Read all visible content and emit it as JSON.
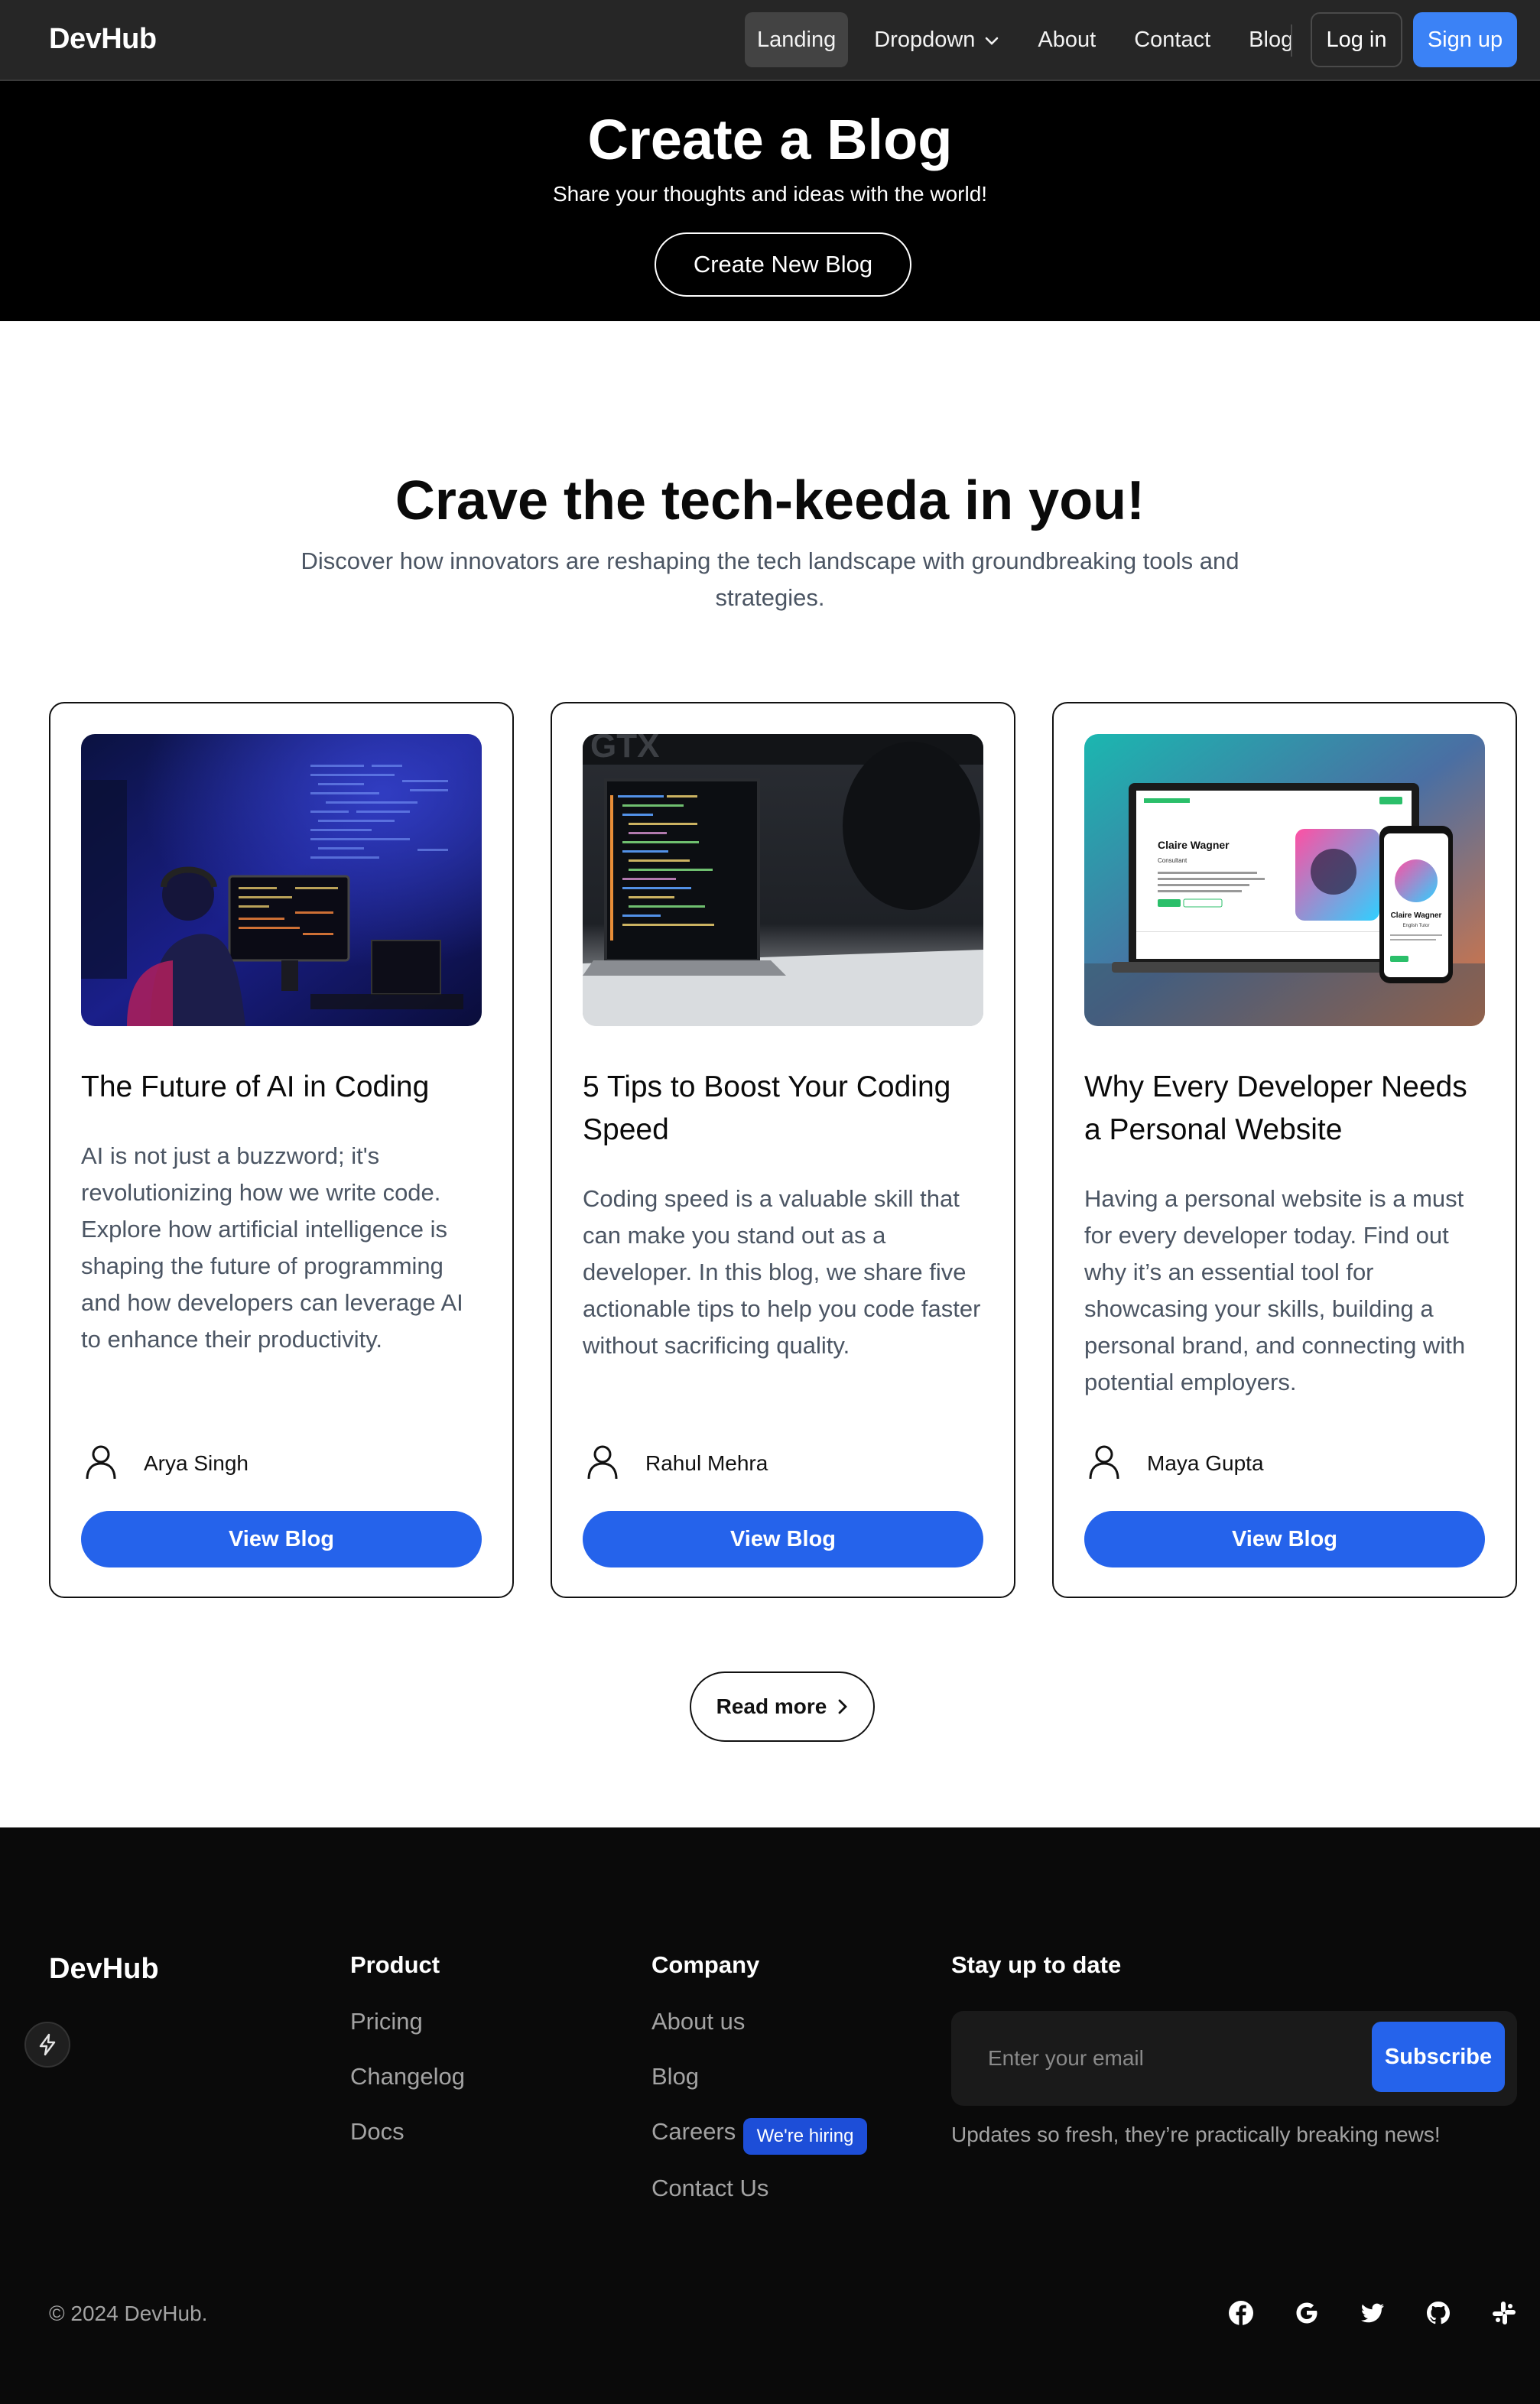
{
  "nav": {
    "brand": "DevHub",
    "links": [
      {
        "label": "Landing",
        "active": true
      },
      {
        "label": "Dropdown"
      },
      {
        "label": "About"
      },
      {
        "label": "Contact"
      },
      {
        "label": "Blog"
      }
    ],
    "login_label": "Log in",
    "signup_label": "Sign up"
  },
  "hero": {
    "title": "Create a Blog",
    "subtitle": "Share your thoughts and ideas with the world!",
    "button_label": "Create New Blog"
  },
  "section": {
    "title": "Crave the tech-keeda in you!",
    "subtitle": "Discover how innovators are reshaping the tech landscape with groundbreaking tools and strategies."
  },
  "posts": [
    {
      "title": "The Future of AI in Coding",
      "description": "AI is not just a buzzword; it's revolutionizing how we write code. Explore how artificial intelligence is shaping the future of programming and how developers can leverage AI to enhance their productivity.",
      "author": "Arya Singh",
      "button_label": "View Blog"
    },
    {
      "title": "5 Tips to Boost Your Coding Speed",
      "description": "Coding speed is a valuable skill that can make you stand out as a developer. In this blog, we share five actionable tips to help you code faster without sacrificing quality.",
      "author": "Rahul Mehra",
      "button_label": "View Blog"
    },
    {
      "title": "Why Every Developer Needs a Personal Website",
      "description": "Having a personal website is a must for every developer today. Find out why it’s an essential tool for showcasing your skills, building a personal brand, and connecting with potential employers.",
      "author": "Maya Gupta",
      "button_label": "View Blog",
      "image_text": {
        "name": "Claire Wagner",
        "role": "Consultant",
        "mobile_name": "Claire Wagner",
        "mobile_role": "English Tutor"
      }
    }
  ],
  "read_more_label": "Read more",
  "footer": {
    "brand": "DevHub",
    "product": {
      "title": "Product",
      "links": [
        "Pricing",
        "Changelog",
        "Docs"
      ]
    },
    "company": {
      "title": "Company",
      "links": [
        "About us",
        "Blog",
        "Careers",
        "Contact Us"
      ],
      "hiring_badge": "We're hiring"
    },
    "newsletter": {
      "title": "Stay up to date",
      "placeholder": "Enter your email",
      "button_label": "Subscribe",
      "note": "Updates so fresh, they’re practically breaking news!"
    },
    "copyright": "© 2024 DevHub.",
    "socials": [
      "facebook-icon",
      "google-icon",
      "twitter-icon",
      "github-icon",
      "slack-icon"
    ]
  },
  "colors": {
    "nav_bg": "#262626",
    "accent": "#2563eb",
    "signup": "#3b82f6",
    "footer_bg": "#0a0a0a"
  }
}
